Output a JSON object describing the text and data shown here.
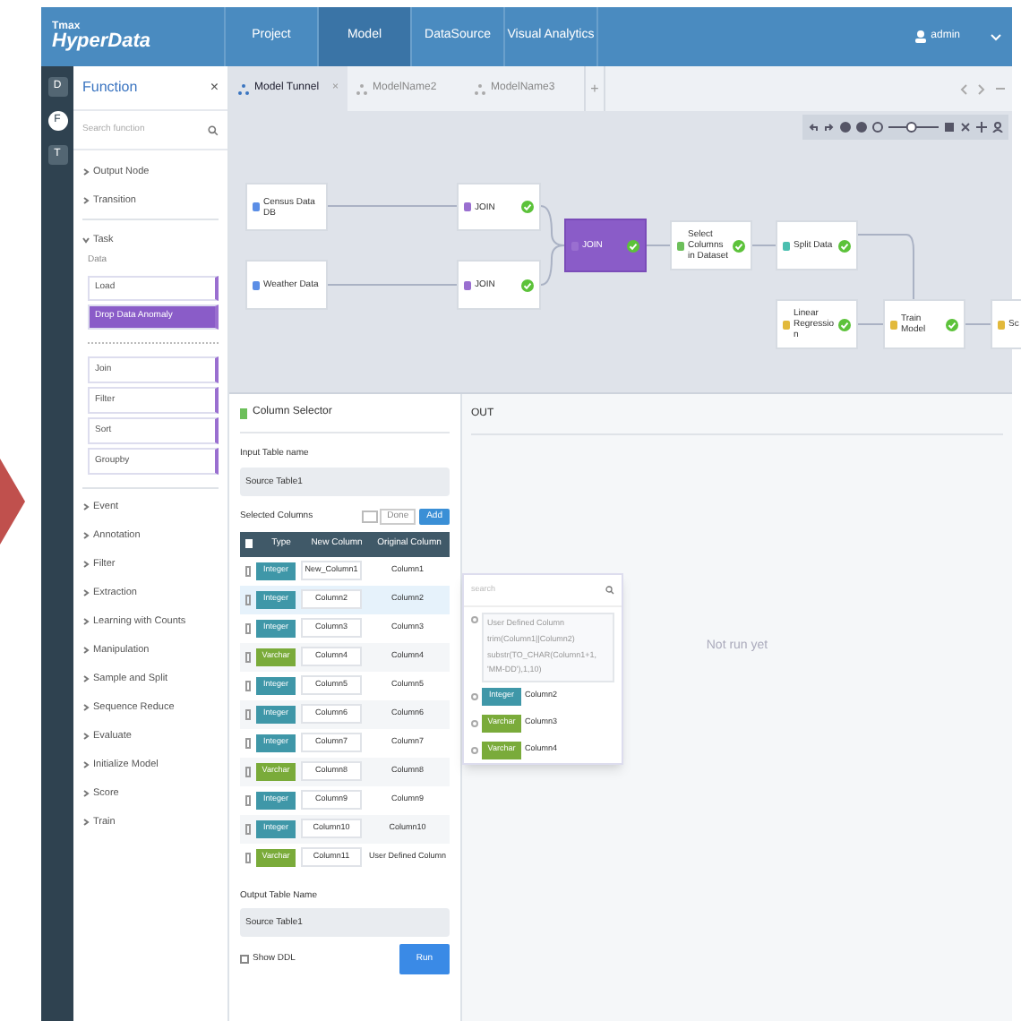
{
  "header": {
    "logo_small": "Tmax",
    "logo": "HyperData",
    "nav": [
      {
        "label": "Project",
        "selected": false
      },
      {
        "label": "Model",
        "selected": true
      },
      {
        "label": "DataSource",
        "selected": false
      },
      {
        "label": "Visual Analytics",
        "selected": false
      }
    ],
    "user": "admin"
  },
  "rail": [
    {
      "label": "D",
      "selected": false
    },
    {
      "label": "F",
      "selected": true
    },
    {
      "label": "T",
      "selected": false
    }
  ],
  "function_panel": {
    "title": "Function",
    "close": "×",
    "search_placeholder": "Search function",
    "groups": [
      {
        "label": "Output Node",
        "expanded": false
      },
      {
        "label": "Transition",
        "expanded": false
      },
      {
        "label": "Task",
        "expanded": true,
        "subheading": "Data",
        "items": [
          {
            "label": "Load",
            "selected": false
          },
          {
            "label": "Drop Data Anomaly",
            "selected": true
          }
        ],
        "items2": [
          {
            "label": "Join",
            "selected": false
          },
          {
            "label": "Filter",
            "selected": false
          },
          {
            "label": "Sort",
            "selected": false
          },
          {
            "label": "Groupby",
            "selected": false
          }
        ]
      },
      {
        "label": "Event",
        "expanded": false
      },
      {
        "label": "Annotation",
        "expanded": false
      },
      {
        "label": "Filter",
        "expanded": false
      },
      {
        "label": "Extraction",
        "expanded": false
      },
      {
        "label": "Learning with Counts",
        "expanded": false
      },
      {
        "label": "Manipulation",
        "expanded": false
      },
      {
        "label": "Sample and Split",
        "expanded": false
      },
      {
        "label": "Sequence Reduce",
        "expanded": false
      },
      {
        "label": "Evaluate",
        "expanded": false
      },
      {
        "label": "Initialize Model",
        "expanded": false
      },
      {
        "label": "Score",
        "expanded": false
      },
      {
        "label": "Train",
        "expanded": false
      }
    ]
  },
  "model_tabs": [
    {
      "label": "Model Tunnel",
      "selected": true,
      "close": "×"
    },
    {
      "label": "ModelName2",
      "selected": false
    },
    {
      "label": "ModelName3",
      "selected": false
    }
  ],
  "add_tab": "+",
  "zoom": {
    "level": 0.45
  },
  "canvas": {
    "nodes": [
      {
        "kind": "source",
        "label": "Census Data DB",
        "selected": false,
        "done": false
      },
      {
        "kind": "source",
        "label": "Weather Data",
        "selected": false,
        "done": false
      },
      {
        "kind": "join",
        "label": "JOIN",
        "selected": false,
        "done": true
      },
      {
        "kind": "join",
        "label": "JOIN",
        "selected": false,
        "done": true
      },
      {
        "kind": "join",
        "label": "JOIN",
        "selected": true,
        "done": true
      },
      {
        "kind": "select",
        "label": "Select Columns in Dataset",
        "selected": false,
        "done": true
      },
      {
        "kind": "split",
        "label": "Split Data",
        "selected": false,
        "done": true
      },
      {
        "kind": "model",
        "label": "Linear Regression",
        "selected": false,
        "done": true
      },
      {
        "kind": "model",
        "label": "Train Model",
        "selected": false,
        "done": true
      },
      {
        "kind": "model",
        "label": "Sc",
        "selected": false,
        "done": false
      }
    ]
  },
  "column_selector": {
    "title": "Column Selector",
    "input_label": "Input Table name",
    "input_value": "Source Table1",
    "selected_label": "Selected Columns",
    "done_button": "Done",
    "add_button": "Add",
    "columns": [
      "Type",
      "New Column",
      "Original Column"
    ],
    "all_checked": false,
    "rows": [
      {
        "type": "Integer",
        "kind": "integer",
        "new": "New_Column1",
        "original": "Column1",
        "checked": false,
        "selected": false
      },
      {
        "type": "Integer",
        "kind": "integer",
        "new": "Column2",
        "original": "Column2",
        "checked": false,
        "selected": true
      },
      {
        "type": "Integer",
        "kind": "integer",
        "new": "Column3",
        "original": "Column3",
        "checked": false,
        "selected": false
      },
      {
        "type": "Varchar",
        "kind": "varchar",
        "new": "Column4",
        "original": "Column4",
        "checked": false,
        "selected": false
      },
      {
        "type": "Integer",
        "kind": "integer",
        "new": "Column5",
        "original": "Column5",
        "checked": false,
        "selected": false
      },
      {
        "type": "Integer",
        "kind": "integer",
        "new": "Column6",
        "original": "Column6",
        "checked": false,
        "selected": false
      },
      {
        "type": "Integer",
        "kind": "integer",
        "new": "Column7",
        "original": "Column7",
        "checked": false,
        "selected": false
      },
      {
        "type": "Varchar",
        "kind": "varchar",
        "new": "Column8",
        "original": "Column8",
        "checked": false,
        "selected": false
      },
      {
        "type": "Integer",
        "kind": "integer",
        "new": "Column9",
        "original": "Column9",
        "checked": false,
        "selected": false
      },
      {
        "type": "Integer",
        "kind": "integer",
        "new": "Column10",
        "original": "Column10",
        "checked": false,
        "selected": false
      },
      {
        "type": "Varchar",
        "kind": "varchar",
        "new": "Column11",
        "original": "User Defined Column",
        "checked": false,
        "selected": false
      }
    ],
    "output_label": "Output Table Name",
    "output_value": "Source Table1",
    "show_ddl": {
      "label": "Show DDL",
      "checked": false
    },
    "run_button": "Run"
  },
  "output_panel": {
    "title": "OUT",
    "message": "Not run yet"
  },
  "popup": {
    "search_placeholder": "search",
    "expression_checked": false,
    "expression": [
      "User Defined Column",
      "trim(Column1||Column2)",
      "substr(TO_CHAR(Column1+1,",
      "'MM-DD'),1,10)"
    ],
    "items": [
      {
        "type": "Integer",
        "kind": "integer",
        "label": "Column2",
        "checked": false
      },
      {
        "type": "Varchar",
        "kind": "varchar",
        "label": "Column3",
        "checked": false
      },
      {
        "type": "Varchar",
        "kind": "varchar",
        "label": "Column4",
        "checked": false
      }
    ]
  }
}
